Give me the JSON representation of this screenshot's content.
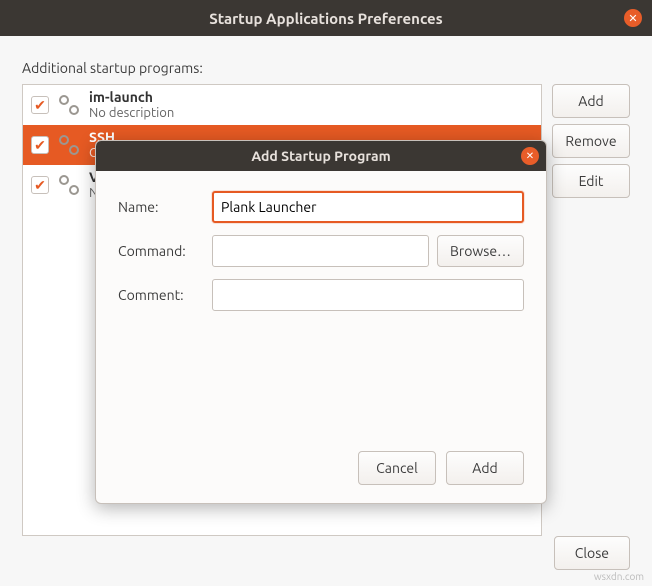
{
  "colors": {
    "accent": "#e65a23",
    "titlebar": "#3b3733"
  },
  "main": {
    "title": "Startup Applications Preferences",
    "section_label": "Additional startup programs:",
    "rows": [
      {
        "title": "im-launch",
        "sub": "No description",
        "checked": true,
        "selected": false
      },
      {
        "title": "SSH",
        "sub": "GN",
        "checked": true,
        "selected": true
      },
      {
        "title": "VM",
        "sub": "No",
        "checked": true,
        "selected": false
      }
    ],
    "buttons": {
      "add": "Add",
      "remove": "Remove",
      "edit": "Edit"
    },
    "close": "Close"
  },
  "modal": {
    "title": "Add Startup Program",
    "labels": {
      "name": "Name:",
      "command": "Command:",
      "comment": "Comment:"
    },
    "values": {
      "name": "Plank Launcher",
      "command": "",
      "comment": ""
    },
    "browse": "Browse…",
    "cancel": "Cancel",
    "add": "Add"
  },
  "watermark": "wsxdn.com"
}
